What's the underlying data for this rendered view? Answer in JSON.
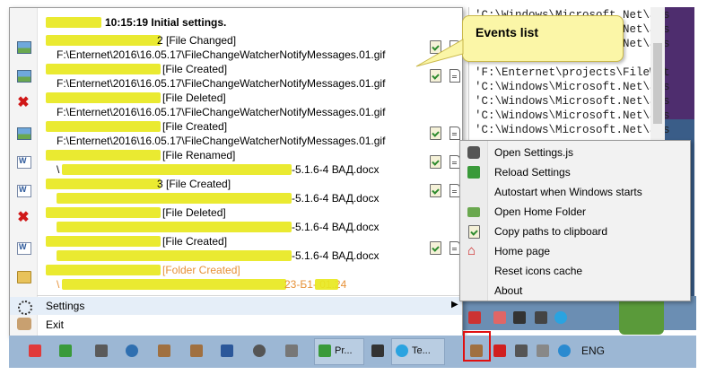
{
  "colors": {
    "highlight": "#e8e820",
    "folder_created_text": "#e69138",
    "callout_bg": "#fbf6a7",
    "tray_highlight": "#e01010"
  },
  "console": {
    "lines": [
      "'C:\\Windows\\Microsoft.Net\\ass",
      "'C:\\Windows\\Microsoft.Net\\ass",
      "'C:\\Windows\\Microsoft.Net\\ass",
      "'F:\\Enternet\\projects\\FileWat",
      "'C:\\Windows\\Microsoft.Net\\ass",
      "'C:\\Windows\\Microsoft.Net\\ass",
      "'C:\\Windows\\Microsoft.Net\\ass",
      "'C:\\Windows\\Microsoft.Net\\ass",
      "'C:\\Windows\\Microsoft.Net\\ass"
    ]
  },
  "callout": {
    "text": "Events list"
  },
  "events": {
    "header_time": "10:15:19 Initial settings.",
    "items": [
      {
        "icon": "image-icon",
        "status": "2 [File Changed]",
        "path": "F:\\Enternet\\2016\\16.05.17\\FileChangeWatcherNotifyMessages.01.gif"
      },
      {
        "icon": "image-icon",
        "status": "[File Created]",
        "path": "F:\\Enternet\\2016\\16.05.17\\FileChangeWatcherNotifyMessages.01.gif"
      },
      {
        "icon": "delete-icon",
        "status": "[File Deleted]",
        "path": "F:\\Enternet\\2016\\16.05.17\\FileChangeWatcherNotifyMessages.01.gif"
      },
      {
        "icon": "image-icon",
        "status": "[File Created]",
        "path": "F:\\Enternet\\2016\\16.05.17\\FileChangeWatcherNotifyMessages.01.gif"
      },
      {
        "icon": "word-doc-icon",
        "status": "[File Renamed]",
        "path": "-5.1.6-4 ВАД.docx"
      },
      {
        "icon": "word-doc-icon",
        "status": "3 [File Created]",
        "path": "-5.1.6-4 ВАД.docx"
      },
      {
        "icon": "delete-icon",
        "status": "[File Deleted]",
        "path": "-5.1.6-4 ВАД.docx"
      },
      {
        "icon": "word-doc-icon",
        "status": "[File Created]",
        "path": "-5.1.6-4 ВАД.docx"
      },
      {
        "icon": "folder-icon",
        "status": "[Folder Created]",
        "path_prefix": "\\",
        "path": "23-Б1-  01.24"
      }
    ]
  },
  "bottom_menu": {
    "settings": "Settings",
    "exit": "Exit"
  },
  "context_menu": {
    "items": [
      "Open Settings.js",
      "Reload Settings",
      "Autostart when Windows starts",
      "Open Home Folder",
      "Copy paths to clipboard",
      "Home page",
      "Reset icons cache",
      "About"
    ]
  },
  "taskbar": {
    "btn_pr": "Pr...",
    "btn_te": "Te...",
    "lang": "ENG"
  }
}
